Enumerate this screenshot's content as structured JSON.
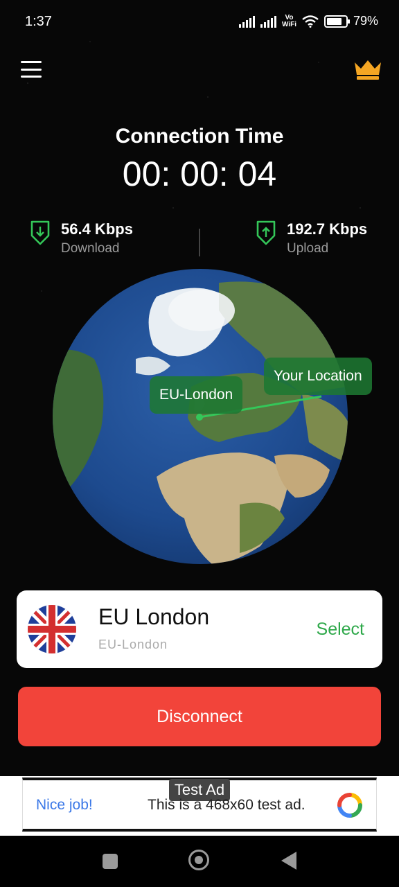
{
  "status_bar": {
    "time": "1:37",
    "vowifi_top": "Vo",
    "vowifi_bottom": "WiFi",
    "battery": "79%"
  },
  "header": {
    "menu_icon": "hamburger-menu-icon",
    "premium_icon": "crown-icon",
    "accent_color": "#f5a623"
  },
  "connection": {
    "title": "Connection Time",
    "time": "00: 00: 04"
  },
  "stats": {
    "download": {
      "value": "56.4 Kbps",
      "label": "Download",
      "icon": "download-shield-icon"
    },
    "upload": {
      "value": "192.7 Kbps",
      "label": "Upload",
      "icon": "upload-shield-icon"
    },
    "accent_color": "#34c759"
  },
  "map": {
    "server_label": "EU-London",
    "user_label": "Your Location"
  },
  "server": {
    "name": "EU London",
    "subtitle": "EU-London",
    "select_label": "Select",
    "flag": "uk-flag-icon"
  },
  "action": {
    "disconnect_label": "Disconnect",
    "color": "#f2443a"
  },
  "ad": {
    "tag": "Test Ad",
    "headline": "Nice job!",
    "body": "This is a 468x60 test ad."
  },
  "navigation": {
    "recents_icon": "square-icon",
    "home_icon": "home-circle-icon",
    "back_icon": "back-triangle-icon"
  }
}
